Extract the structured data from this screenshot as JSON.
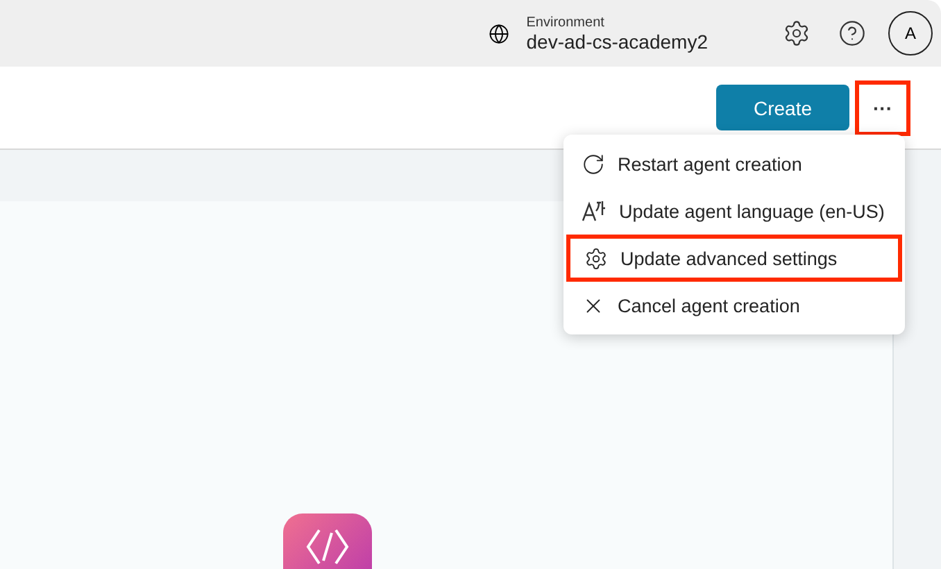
{
  "header": {
    "environment_label": "Environment",
    "environment_name": "dev-ad-cs-academy2",
    "avatar_initial": "A"
  },
  "toolbar": {
    "create_button": "Create",
    "more_button": {
      "label": "···",
      "annotated": true
    }
  },
  "menu": {
    "items": [
      {
        "kind": "restart",
        "label": "Restart agent creation",
        "annotated": false
      },
      {
        "kind": "language",
        "label": "Update agent language (en-US)",
        "annotated": false
      },
      {
        "kind": "settings",
        "label": "Update advanced settings",
        "annotated": true
      },
      {
        "kind": "cancel",
        "label": "Cancel agent creation",
        "annotated": false
      }
    ]
  }
}
